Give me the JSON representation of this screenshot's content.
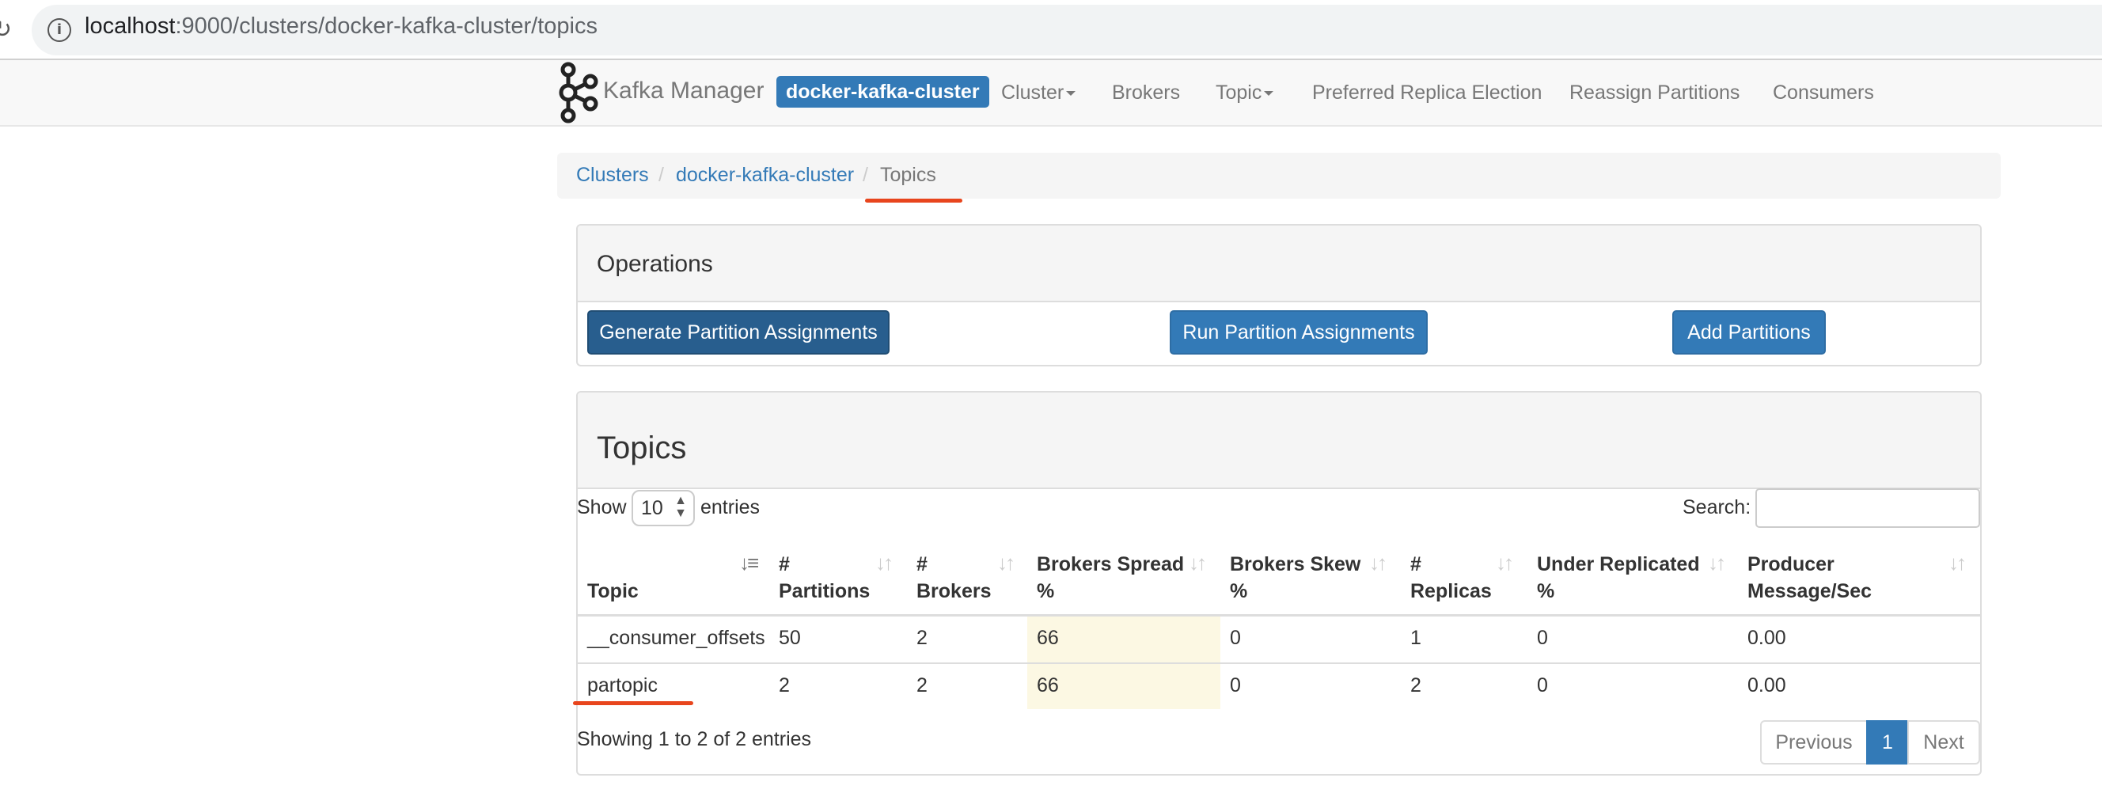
{
  "browser": {
    "url_host": "localhost",
    "url_path": ":9000/clusters/docker-kafka-cluster/topics"
  },
  "navbar": {
    "brand": "Kafka Manager",
    "cluster_label": "docker-kafka-cluster",
    "links": [
      "Cluster",
      "Brokers",
      "Topic",
      "Preferred Replica Election",
      "Reassign Partitions",
      "Consumers"
    ]
  },
  "breadcrumb": {
    "items": [
      "Clusters",
      "docker-kafka-cluster",
      "Topics"
    ],
    "separator": "/"
  },
  "operations": {
    "title": "Operations",
    "buttons": [
      "Generate Partition Assignments",
      "Run Partition Assignments",
      "Add Partitions"
    ]
  },
  "topics": {
    "title": "Topics",
    "show_label": "Show",
    "entries_label": "entries",
    "page_length": "10",
    "search_label": "Search:",
    "columns": [
      {
        "line1": "",
        "line2": "Topic"
      },
      {
        "line1": "#",
        "line2": "Partitions"
      },
      {
        "line1": "#",
        "line2": "Brokers"
      },
      {
        "line1": "Brokers Spread",
        "line2": "%"
      },
      {
        "line1": "Brokers Skew",
        "line2": "%"
      },
      {
        "line1": "#",
        "line2": "Replicas"
      },
      {
        "line1": "Under Replicated",
        "line2": "%"
      },
      {
        "line1": "Producer",
        "line2": "Message/Sec"
      }
    ],
    "rows": [
      [
        "__consumer_offsets",
        "50",
        "2",
        "66",
        "0",
        "1",
        "0",
        "0.00"
      ],
      [
        "partopic",
        "2",
        "2",
        "66",
        "0",
        "2",
        "0",
        "0.00"
      ]
    ],
    "info": "Showing 1 to 2 of 2 entries",
    "pagination": {
      "previous": "Previous",
      "current": "1",
      "next": "Next"
    }
  },
  "colors": {
    "accent": "#337ab7",
    "highlight": "#fcf8e3",
    "annotation": "#e8451d"
  }
}
